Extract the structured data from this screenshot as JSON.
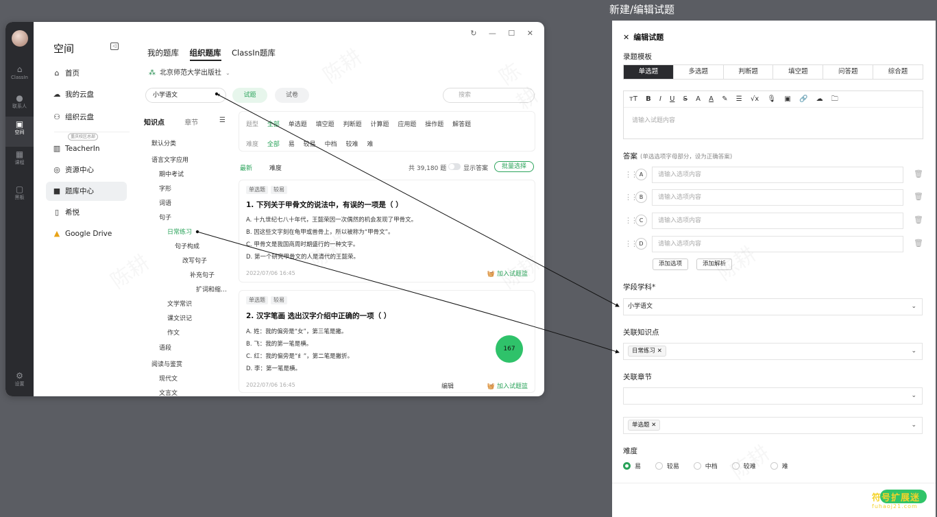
{
  "page_title": "新建/编辑试题",
  "rail": [
    {
      "label": "ClassIn",
      "icon": "home-icon"
    },
    {
      "label": "联系人",
      "icon": "contacts-icon"
    },
    {
      "label": "空间",
      "icon": "space-icon"
    },
    {
      "label": "课程",
      "icon": "calendar-icon"
    },
    {
      "label": "黑板",
      "icon": "board-icon"
    },
    {
      "label": "设置",
      "icon": "settings-icon"
    }
  ],
  "sidebar": {
    "title": "空间",
    "items": [
      {
        "label": "首页",
        "icon": "home-icon"
      },
      {
        "label": "我的云盘",
        "icon": "cloud-icon"
      },
      {
        "label": "组织云盘",
        "icon": "org-cloud-icon",
        "badge": "重庆校区总部"
      },
      {
        "label": "TeacherIn",
        "icon": "book-icon"
      },
      {
        "label": "资源中心",
        "icon": "compass-icon"
      },
      {
        "label": "题库中心",
        "icon": "question-bank-icon"
      },
      {
        "label": "希悦",
        "icon": "app-icon"
      },
      {
        "label": "Google Drive",
        "icon": "drive-icon"
      }
    ]
  },
  "main": {
    "tabs": [
      "我的题库",
      "组织题库",
      "ClassIn题库"
    ],
    "publisher": "北京师范大学出版社",
    "subject": "小学语文",
    "type_tabs": [
      "试题",
      "试卷"
    ],
    "search_placeholder": "搜索",
    "kp_tabs": [
      "知识点",
      "章节"
    ],
    "tree": [
      "默认分类",
      "语言文字应用",
      "期中考试",
      "字形",
      "词语",
      "句子",
      "日常练习",
      "句子构成",
      "改写句子",
      "补充句子",
      "扩词和缩…",
      "文学常识",
      "课文识记",
      "作文",
      "语段",
      "阅读与鉴赏",
      "现代文",
      "文言文"
    ],
    "filter": {
      "type_label": "题型",
      "types": [
        "全部",
        "单选题",
        "填空题",
        "判断题",
        "计算题",
        "应用题",
        "操作题",
        "解答题"
      ],
      "difficulty_label": "难度",
      "difficulties": [
        "全部",
        "易",
        "较易",
        "中档",
        "较难",
        "难"
      ]
    },
    "sort": {
      "newest": "最新",
      "difficulty": "难度",
      "total": "共 39,180 题",
      "show_answer": "显示答案",
      "batch": "批量选择"
    },
    "questions": [
      {
        "tags": [
          "单选题",
          "较易"
        ],
        "title": "1. 下列关于甲骨文的说法中，有误的一项是（ ）",
        "options": [
          "A. 十九世纪七八十年代，王懿荣因一次偶然的机会发现了甲骨文。",
          "B. 因这些文字刻在龟甲或兽骨上，所以被称为“甲骨文”。",
          "C. 甲骨文是我国商周时期盛行的一种文字。",
          "D. 第一个研究甲骨文的人是清代的王懿荣。"
        ],
        "time": "2022/07/06 16:45",
        "add": "加入试题篮"
      },
      {
        "tags": [
          "单选题",
          "较易"
        ],
        "title": "2. 汉字笔画 选出汉字介绍中正确的一项（ ）",
        "options": [
          "A. 姓：我的偏旁是“女”，第三笔是撇。",
          "B. 飞：我的第一笔是横。",
          "C. 红：我的偏旁是“纟”，第二笔是撇折。",
          "D. 李：第一笔是横。"
        ],
        "time": "2022/07/06 16:45",
        "edit": "编辑",
        "add": "加入试题篮"
      }
    ],
    "basket_count": "167"
  },
  "panel": {
    "header": "编辑试题",
    "template_label": "录题模板",
    "templates": [
      "单选题",
      "多选题",
      "判断题",
      "填空题",
      "问答题",
      "综合题"
    ],
    "editor_toolbar": [
      "тT",
      "B",
      "I",
      "U",
      "S",
      "A",
      "A",
      "✎",
      "☰",
      "√x",
      "🎙",
      "▣",
      "🔗",
      "☁",
      "🗀"
    ],
    "editor_placeholder": "请输入试题内容",
    "answer_label": "答案",
    "answer_hint": "(单选选项字母部分，设为正确答案)",
    "options": [
      {
        "letter": "A",
        "placeholder": "请输入选项内容"
      },
      {
        "letter": "B",
        "placeholder": "请输入选项内容"
      },
      {
        "letter": "C",
        "placeholder": "请输入选项内容"
      },
      {
        "letter": "D",
        "placeholder": "请输入选项内容"
      }
    ],
    "add_option": "添加选项",
    "add_analysis": "添加解析",
    "subject_label": "学段学科*",
    "subject_value": "小学语文",
    "kp_label": "关联知识点",
    "kp_chip": "日常练习",
    "chapter_label": "关联章节",
    "type_chip": "单选题",
    "difficulty_label": "难度",
    "difficulties": [
      "易",
      "较易",
      "中档",
      "较难",
      "难"
    ],
    "difficulty_selected": "易"
  },
  "logo": {
    "line1": "符号扩展迷",
    "line2": "fuhaoj21.com"
  },
  "colors": {
    "accent": "#2aa35a",
    "dark": "#2a2b2f",
    "background": "#5b5d63"
  }
}
